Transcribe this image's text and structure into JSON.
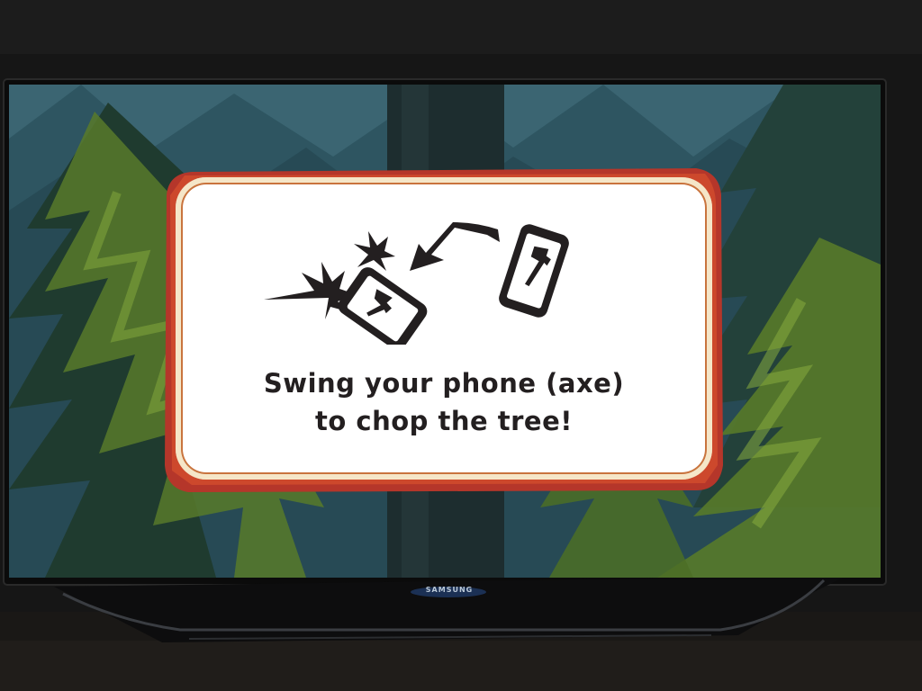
{
  "tv": {
    "brand": "SAMSUNG"
  },
  "game": {
    "instruction_line1": "Swing your phone (axe)",
    "instruction_line2": "to chop the tree!"
  },
  "icons": [
    "phone-with-axe-icon",
    "impact-burst-icon",
    "swing-arrow-icon"
  ],
  "colors": {
    "dialog_border_outer": "#b5362a",
    "dialog_border_inner": "#e8c6a0",
    "dialog_fill": "#ffffff",
    "text": "#231f20",
    "sky": "#2f4f5c",
    "tree_light": "#6b8f2c",
    "tree_dark": "#1f3a2c"
  }
}
